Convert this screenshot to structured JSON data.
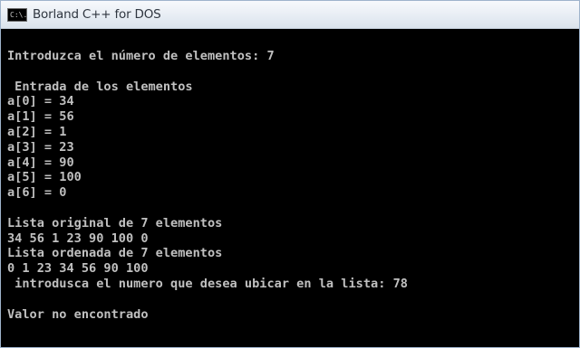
{
  "window": {
    "title": "Borland C++ for DOS",
    "icon": "console-window-icon",
    "icon_text": "C:\\."
  },
  "console": {
    "text_color": "#c0c0c0",
    "background": "#000000",
    "lines": [
      "Introduzca el número de elementos: 7",
      "",
      " Entrada de los elementos",
      "a[0] = 34",
      "a[1] = 56",
      "a[2] = 1",
      "a[3] = 23",
      "a[4] = 90",
      "a[5] = 100",
      "a[6] = 0",
      "",
      "Lista original de 7 elementos",
      "34 56 1 23 90 100 0",
      "Lista ordenada de 7 elementos",
      "0 1 23 34 56 90 100",
      " introdusca el numero que desea ubicar en la lista: 78",
      "",
      "Valor no encontrado"
    ]
  }
}
